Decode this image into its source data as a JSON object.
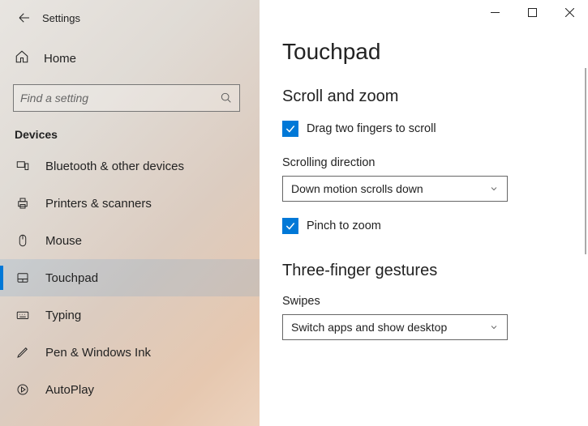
{
  "app_title": "Settings",
  "home_label": "Home",
  "search_placeholder": "Find a setting",
  "section_header": "Devices",
  "nav": [
    {
      "id": "bluetooth",
      "label": "Bluetooth & other devices"
    },
    {
      "id": "printers",
      "label": "Printers & scanners"
    },
    {
      "id": "mouse",
      "label": "Mouse"
    },
    {
      "id": "touchpad",
      "label": "Touchpad"
    },
    {
      "id": "typing",
      "label": "Typing"
    },
    {
      "id": "pen",
      "label": "Pen & Windows Ink"
    },
    {
      "id": "autoplay",
      "label": "AutoPlay"
    }
  ],
  "page_title": "Touchpad",
  "sections": {
    "scroll_zoom": {
      "heading": "Scroll and zoom",
      "drag_label": "Drag two fingers to scroll",
      "drag_checked": true,
      "direction_label": "Scrolling direction",
      "direction_value": "Down motion scrolls down",
      "pinch_label": "Pinch to zoom",
      "pinch_checked": true
    },
    "three_finger": {
      "heading": "Three-finger gestures",
      "swipes_label": "Swipes",
      "swipes_value": "Switch apps and show desktop"
    }
  },
  "colors": {
    "accent": "#0078d7"
  }
}
